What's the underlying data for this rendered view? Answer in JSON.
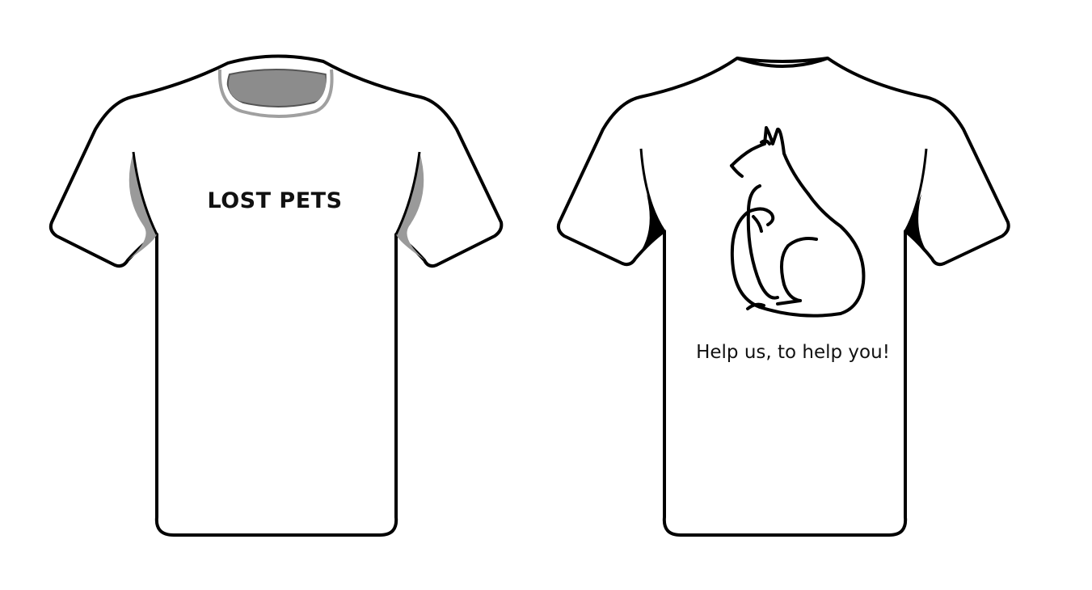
{
  "front": {
    "print_text": "LOST PETS"
  },
  "back": {
    "print_text": "Help us, to help you!",
    "graphic": "cat-outline"
  },
  "colors": {
    "shirt_fill": "#ffffff",
    "outline": "#000000",
    "shading": "#9a9a9a",
    "collar_inner": "#8c8c8c"
  }
}
